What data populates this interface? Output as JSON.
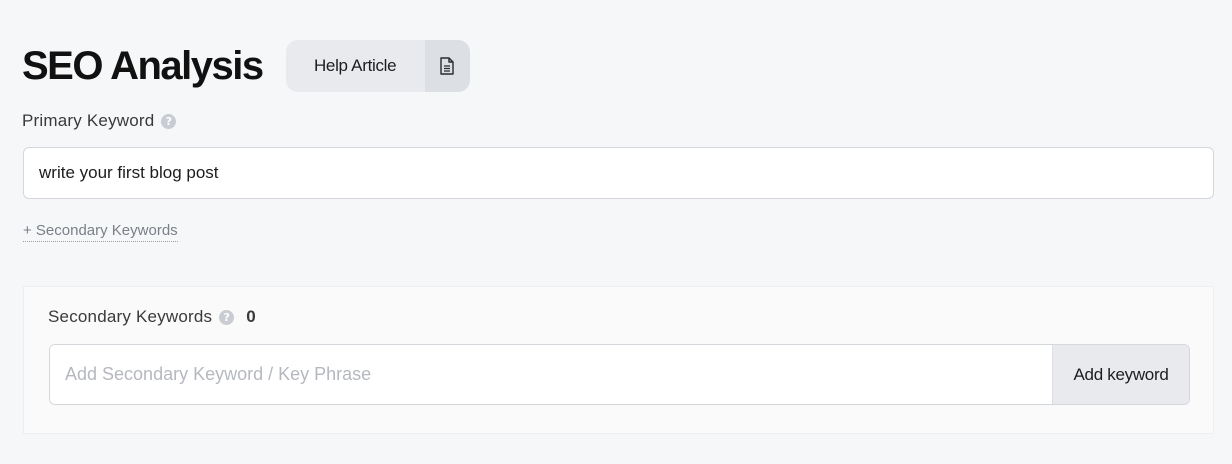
{
  "header": {
    "title": "SEO Analysis",
    "help_label": "Help Article",
    "help_icon": "document-icon"
  },
  "primary": {
    "label": "Primary Keyword",
    "help_icon": "question-icon",
    "value": "write your first blog post"
  },
  "secondary_link": "+ Secondary Keywords",
  "secondary": {
    "label": "Secondary Keywords",
    "help_icon": "question-icon",
    "count": "0",
    "placeholder": "Add Secondary Keyword / Key Phrase",
    "add_label": "Add keyword"
  },
  "colors": {
    "background": "#f6f7f9",
    "button_bg": "#e8eaee",
    "text": "#1d1d1f",
    "muted": "#7a7f87"
  }
}
